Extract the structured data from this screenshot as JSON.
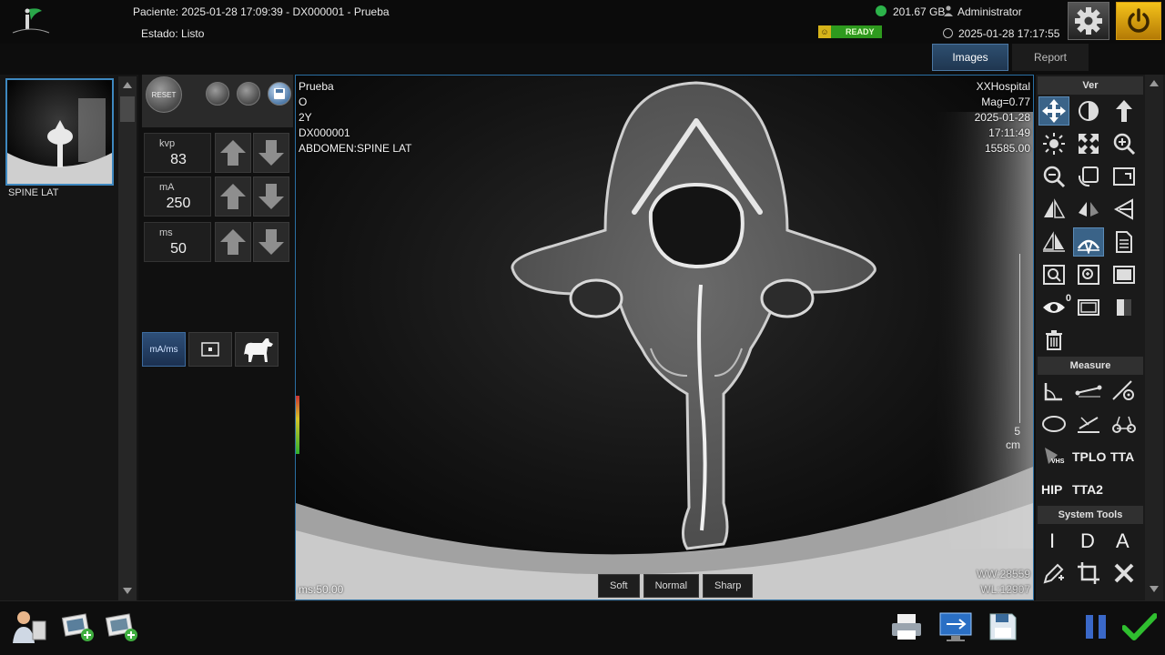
{
  "header": {
    "patient_label": "Paciente:",
    "patient_value": "2025-01-28 17:09:39 - DX000001 - Prueba",
    "status_label": "Estado:",
    "status_value": "Listo",
    "ready_badge": "READY",
    "disk_space": "201.67 GB",
    "user": "Administrator",
    "datetime": "2025-01-28 17:17:55"
  },
  "tabs": [
    {
      "label": "Images",
      "active": true
    },
    {
      "label": "Report",
      "active": false
    }
  ],
  "thumbnails": [
    {
      "label": "SPINE LAT",
      "selected": true
    }
  ],
  "exposure": {
    "reset_label": "RESET",
    "params": [
      {
        "label": "kvp",
        "value": "83"
      },
      {
        "label": "mA",
        "value": "250"
      },
      {
        "label": "ms",
        "value": "50"
      }
    ],
    "mode_label": "mA/ms"
  },
  "viewer": {
    "top_left": [
      "Prueba",
      "O",
      "2Y",
      "DX000001",
      "ABDOMEN:SPINE LAT"
    ],
    "top_right": [
      "XXHospital",
      "Mag=0.77",
      "2025-01-28",
      "17:11:49",
      "15585.00"
    ],
    "bottom_left": "ms:50.00",
    "bottom_right": [
      "WW:28559",
      "WL:12907"
    ],
    "ruler_value": "5",
    "ruler_unit": "cm",
    "filters": [
      "Soft",
      "Normal",
      "Sharp"
    ]
  },
  "tools": {
    "sections": {
      "view": "Ver",
      "measure": "Measure",
      "system": "System Tools"
    },
    "text_tools": {
      "tplo": "TPLO",
      "tta": "TTA",
      "hip": "HIP",
      "tta2": "TTA2",
      "vhs": "VHS",
      "eye_count": "0",
      "tool_i": "I",
      "tool_d": "D",
      "tool_a": "A"
    }
  },
  "colors": {
    "accent_blue": "#3a6388",
    "ready_green": "#2e9a1e",
    "power_yellow": "#f4c21a",
    "confirm_green": "#2fbf2f"
  }
}
